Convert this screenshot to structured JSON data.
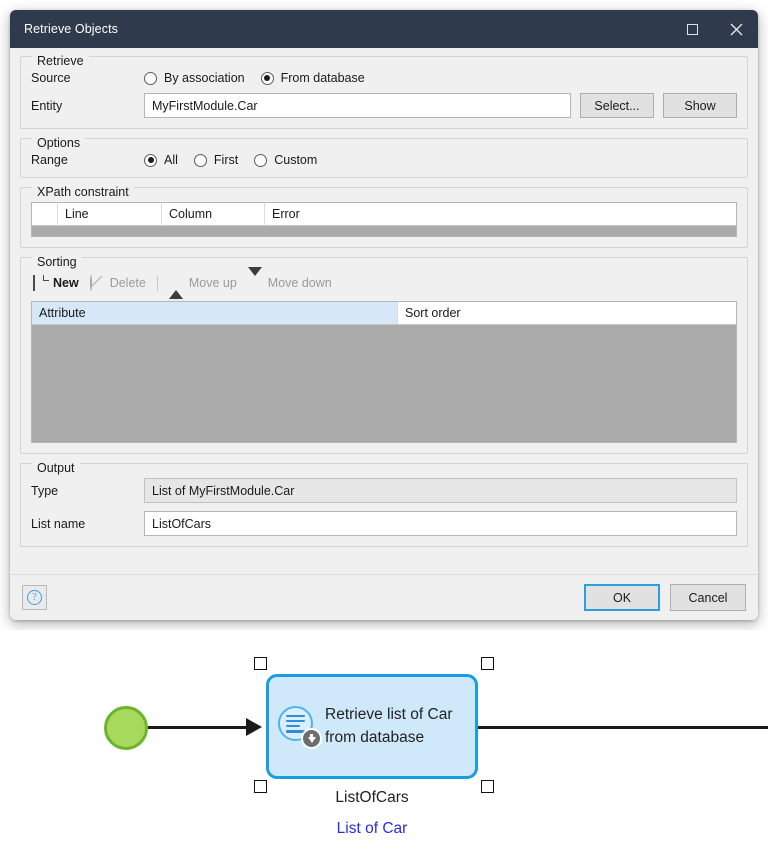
{
  "dialog": {
    "title": "Retrieve Objects",
    "window_buttons": {
      "maximize": "maximize-icon",
      "close": "close-icon"
    },
    "retrieve": {
      "legend": "Retrieve",
      "source_label": "Source",
      "source_options": [
        {
          "label": "By association",
          "checked": false
        },
        {
          "label": "From database",
          "checked": true
        }
      ],
      "entity_label": "Entity",
      "entity_value": "MyFirstModule.Car",
      "select_button": "Select...",
      "show_button": "Show"
    },
    "options": {
      "legend": "Options",
      "range_label": "Range",
      "range_options": [
        {
          "label": "All",
          "checked": true
        },
        {
          "label": "First",
          "checked": false
        },
        {
          "label": "Custom",
          "checked": false
        }
      ]
    },
    "xpath": {
      "legend": "XPath constraint",
      "columns": [
        "",
        "Line",
        "Column",
        "Error"
      ],
      "rows": []
    },
    "sorting": {
      "legend": "Sorting",
      "toolbar": [
        {
          "label": "New",
          "icon": "new-page-icon",
          "enabled": true
        },
        {
          "label": "Delete",
          "icon": "delete-circle-slash-icon",
          "enabled": false
        },
        {
          "label": "Move up",
          "icon": "triangle-up-icon",
          "enabled": false
        },
        {
          "label": "Move down",
          "icon": "triangle-down-icon",
          "enabled": false
        }
      ],
      "columns": [
        "Attribute",
        "Sort order"
      ],
      "selected_column": "Attribute",
      "rows": []
    },
    "output": {
      "legend": "Output",
      "type_label": "Type",
      "type_value": "List of MyFirstModule.Car",
      "list_name_label": "List name",
      "list_name_value": "ListOfCars"
    },
    "footer": {
      "help_icon": "help-question-icon",
      "ok_button": "OK",
      "cancel_button": "Cancel"
    }
  },
  "flow": {
    "start_node": "start-event",
    "activity": {
      "icon": "retrieve-from-database-icon",
      "label": "Retrieve list of Car from database",
      "selected": true
    },
    "caption_name": "ListOfCars",
    "caption_type": "List of Car"
  },
  "colors": {
    "titlebar": "#303a4d",
    "accent_blue": "#1a9de0",
    "activity_fill": "#cfe9fa",
    "start_green": "#a6d95c",
    "start_green_border": "#6ab52b",
    "type_text_blue": "#2a2ae6",
    "selected_header": "#d6e8f7",
    "empty_list_gray": "#aaaaaa"
  }
}
